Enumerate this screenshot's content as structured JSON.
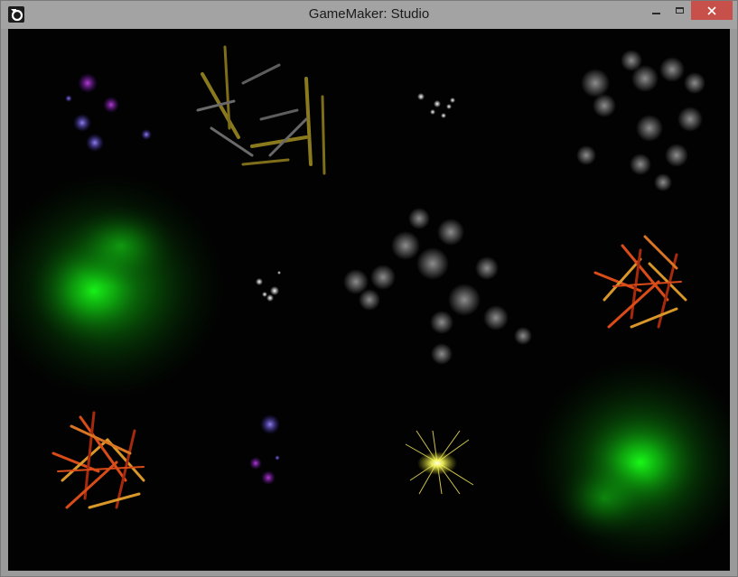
{
  "window": {
    "title": "GameMaker: Studio",
    "icon": "gamemaker-logo-icon",
    "controls": {
      "minimize": "minimize-icon",
      "maximize": "maximize-icon",
      "close": "close-icon"
    }
  },
  "scene": {
    "background_color": "#020202",
    "particle_systems": [
      {
        "kind": "purple-blue orbs",
        "colors": [
          "#a020c0",
          "#6a4cff",
          "#8a6bff"
        ]
      },
      {
        "kind": "yellow-grey streaks",
        "colors": [
          "#b8a227",
          "#8c8c8c"
        ]
      },
      {
        "kind": "white sparks",
        "colors": [
          "#ffffff"
        ]
      },
      {
        "kind": "grey smoke",
        "colors": [
          "#9a9a9a"
        ]
      },
      {
        "kind": "green glow",
        "colors": [
          "#19ff19",
          "#0b8a0b"
        ]
      },
      {
        "kind": "orange-red flares",
        "colors": [
          "#ff5a1e",
          "#ffb030",
          "#c23010"
        ]
      },
      {
        "kind": "yellow starburst",
        "colors": [
          "#ffff80",
          "#fff040"
        ]
      }
    ]
  }
}
